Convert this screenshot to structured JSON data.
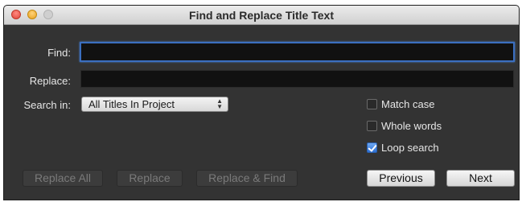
{
  "window": {
    "title": "Find and Replace Title Text"
  },
  "find": {
    "label": "Find:",
    "value": ""
  },
  "replace": {
    "label": "Replace:",
    "value": ""
  },
  "search_in": {
    "label": "Search in:",
    "selected": "All Titles In Project"
  },
  "options": [
    {
      "label": "Match case",
      "checked": false
    },
    {
      "label": "Whole words",
      "checked": false
    },
    {
      "label": "Loop search",
      "checked": true
    }
  ],
  "buttons": {
    "replace_all": "Replace All",
    "replace": "Replace",
    "replace_find": "Replace & Find",
    "previous": "Previous",
    "next": "Next"
  }
}
